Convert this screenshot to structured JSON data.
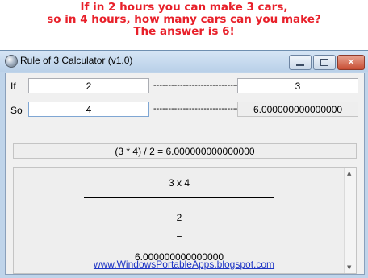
{
  "banner": {
    "line1": "If in 2 hours you can make 3 cars,",
    "line2": "so in 4 hours, how many cars can you make?",
    "line3": "The answer is 6!"
  },
  "window": {
    "title": "Rule of 3 Calculator (v1.0)",
    "icons": {
      "app": "app-globe-icon",
      "minimize": "minimize-icon",
      "maximize": "maximize-icon",
      "close": "close-icon"
    },
    "close_glyph": "✕"
  },
  "row1": {
    "label": "If",
    "input_value": "2",
    "arrow": "-----------------------------------> ",
    "result_value": "3"
  },
  "row2": {
    "label": "So",
    "input_value": "4",
    "arrow": "-----------------------------------> ",
    "result_value": "6.000000000000000"
  },
  "expression": "(3 * 4) / 2 = 6.000000000000000",
  "panel": {
    "numerator": "3 x 4",
    "denominator": "2",
    "equals": "=",
    "result": "6.000000000000000",
    "scroll_up": "▲",
    "scroll_down": "▼"
  },
  "link": "www.WindowsPortableApps.blogspot.com",
  "colors": {
    "banner": "#e8202a",
    "link": "#1d34c5"
  }
}
